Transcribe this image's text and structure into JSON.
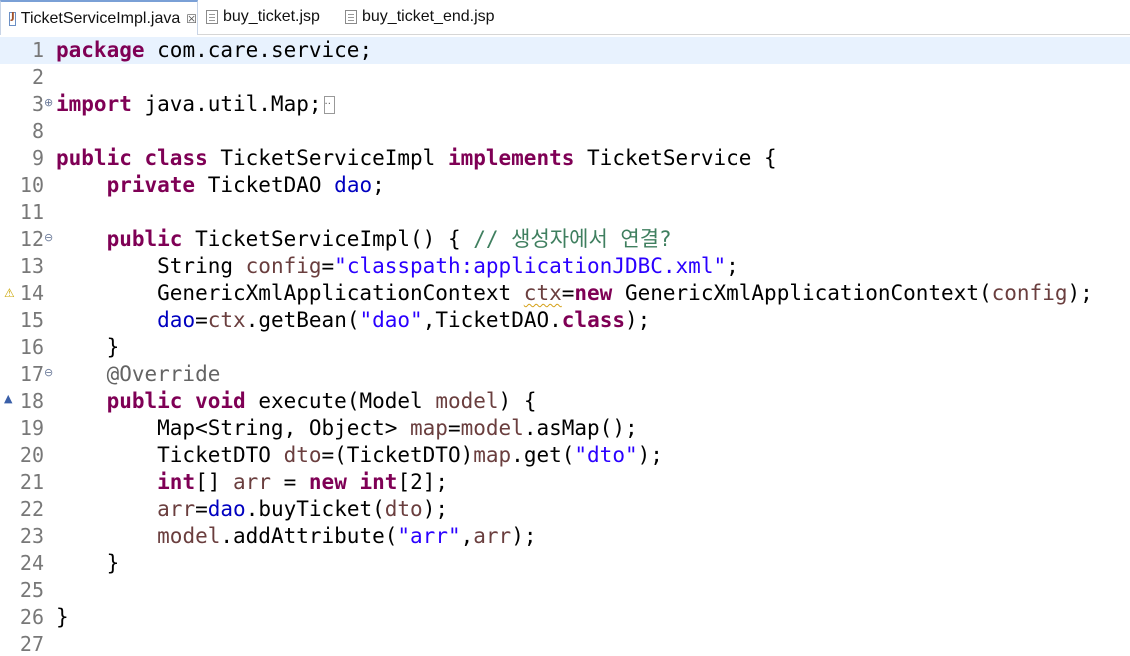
{
  "tabs": [
    {
      "label": "TicketServiceImpl.java",
      "icon": "java-file-icon",
      "active": true,
      "close": "☒"
    },
    {
      "label": "buy_ticket.jsp",
      "icon": "jsp-file-icon",
      "active": false
    },
    {
      "label": "buy_ticket_end.jsp",
      "icon": "jsp-file-icon",
      "active": false
    }
  ],
  "colors": {
    "keyword": "#7f0055",
    "string": "#2a00ff",
    "comment": "#3f7f5f",
    "field": "#0000c0",
    "local_variable": "#6a3e3e",
    "annotation": "#646464",
    "line_number": "#787878",
    "current_line": "#e8f2fe"
  },
  "editor": {
    "lines": [
      {
        "num": "1",
        "tokens": [
          {
            "t": "package",
            "c": "kw"
          },
          {
            "t": " com.care.service;"
          }
        ]
      },
      {
        "num": "2",
        "tokens": []
      },
      {
        "num": "3",
        "tokens": [
          {
            "t": "import",
            "c": "kw"
          },
          {
            "t": " java.util.Map;"
          }
        ]
      },
      {
        "num": "8",
        "tokens": []
      },
      {
        "num": "9",
        "tokens": [
          {
            "t": "public",
            "c": "kw"
          },
          {
            "t": " "
          },
          {
            "t": "class",
            "c": "kw"
          },
          {
            "t": " TicketServiceImpl "
          },
          {
            "t": "implements",
            "c": "kw"
          },
          {
            "t": " TicketService {"
          }
        ]
      },
      {
        "num": "10",
        "tokens": [
          {
            "t": "    "
          },
          {
            "t": "private",
            "c": "kw"
          },
          {
            "t": " TicketDAO "
          },
          {
            "t": "dao",
            "c": "field"
          },
          {
            "t": ";"
          }
        ]
      },
      {
        "num": "11",
        "tokens": []
      },
      {
        "num": "12",
        "tokens": [
          {
            "t": "    "
          },
          {
            "t": "public",
            "c": "kw"
          },
          {
            "t": " TicketServiceImpl() { "
          },
          {
            "t": "// 생성자에서 연결?",
            "c": "cmt"
          }
        ]
      },
      {
        "num": "13",
        "tokens": [
          {
            "t": "        String "
          },
          {
            "t": "config",
            "c": "var"
          },
          {
            "t": "="
          },
          {
            "t": "\"classpath:applicationJDBC.xml\"",
            "c": "str"
          },
          {
            "t": ";"
          }
        ]
      },
      {
        "num": "14",
        "tokens": [
          {
            "t": "        GenericXmlApplicationContext "
          },
          {
            "t": "ctx",
            "c": "var squig"
          },
          {
            "t": "="
          },
          {
            "t": "new",
            "c": "kw"
          },
          {
            "t": " GenericXmlApplicationContext("
          },
          {
            "t": "config",
            "c": "var"
          },
          {
            "t": ");"
          }
        ]
      },
      {
        "num": "15",
        "tokens": [
          {
            "t": "        "
          },
          {
            "t": "dao",
            "c": "field"
          },
          {
            "t": "="
          },
          {
            "t": "ctx",
            "c": "var"
          },
          {
            "t": ".getBean("
          },
          {
            "t": "\"dao\"",
            "c": "str"
          },
          {
            "t": ",TicketDAO."
          },
          {
            "t": "class",
            "c": "kw"
          },
          {
            "t": ");"
          }
        ]
      },
      {
        "num": "16",
        "tokens": [
          {
            "t": "    }"
          }
        ]
      },
      {
        "num": "17",
        "tokens": [
          {
            "t": "    "
          },
          {
            "t": "@Override",
            "c": "ann"
          }
        ]
      },
      {
        "num": "18",
        "tokens": [
          {
            "t": "    "
          },
          {
            "t": "public",
            "c": "kw"
          },
          {
            "t": " "
          },
          {
            "t": "void",
            "c": "kw"
          },
          {
            "t": " execute(Model "
          },
          {
            "t": "model",
            "c": "var"
          },
          {
            "t": ") {"
          }
        ]
      },
      {
        "num": "19",
        "tokens": [
          {
            "t": "        Map<String, Object> "
          },
          {
            "t": "map",
            "c": "var"
          },
          {
            "t": "="
          },
          {
            "t": "model",
            "c": "var"
          },
          {
            "t": ".asMap();"
          }
        ]
      },
      {
        "num": "20",
        "tokens": [
          {
            "t": "        TicketDTO "
          },
          {
            "t": "dto",
            "c": "var"
          },
          {
            "t": "=(TicketDTO)"
          },
          {
            "t": "map",
            "c": "var"
          },
          {
            "t": ".get("
          },
          {
            "t": "\"dto\"",
            "c": "str"
          },
          {
            "t": ");"
          }
        ]
      },
      {
        "num": "21",
        "tokens": [
          {
            "t": "        "
          },
          {
            "t": "int",
            "c": "kw"
          },
          {
            "t": "[] "
          },
          {
            "t": "arr",
            "c": "var"
          },
          {
            "t": " = "
          },
          {
            "t": "new",
            "c": "kw"
          },
          {
            "t": " "
          },
          {
            "t": "int",
            "c": "kw"
          },
          {
            "t": "[2];"
          }
        ]
      },
      {
        "num": "22",
        "tokens": [
          {
            "t": "        "
          },
          {
            "t": "arr",
            "c": "var"
          },
          {
            "t": "="
          },
          {
            "t": "dao",
            "c": "field"
          },
          {
            "t": ".buyTicket("
          },
          {
            "t": "dto",
            "c": "var"
          },
          {
            "t": ");"
          }
        ]
      },
      {
        "num": "23",
        "tokens": [
          {
            "t": "        "
          },
          {
            "t": "model",
            "c": "var"
          },
          {
            "t": ".addAttribute("
          },
          {
            "t": "\"arr\"",
            "c": "str"
          },
          {
            "t": ","
          },
          {
            "t": "arr",
            "c": "var"
          },
          {
            "t": ");"
          }
        ]
      },
      {
        "num": "24",
        "tokens": [
          {
            "t": "    }"
          }
        ]
      },
      {
        "num": "25",
        "tokens": []
      },
      {
        "num": "26",
        "tokens": [
          {
            "t": "}"
          }
        ]
      },
      {
        "num": "27",
        "tokens": []
      }
    ]
  }
}
